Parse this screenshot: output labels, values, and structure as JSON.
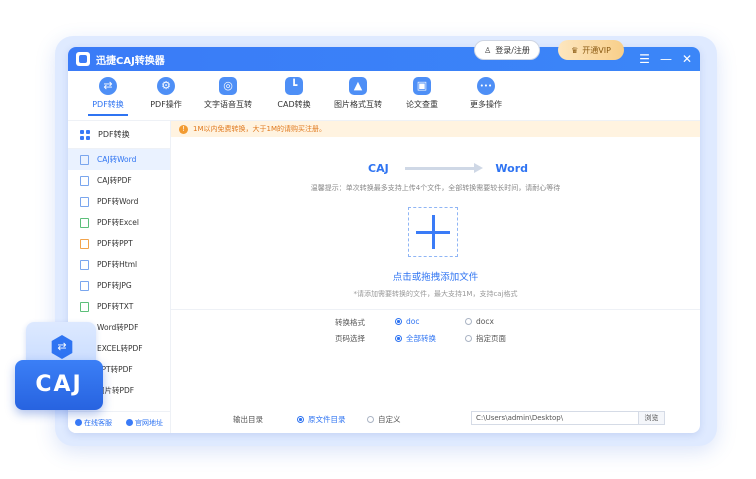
{
  "window": {
    "title": "迅捷CAJ转换器",
    "controls": [
      "☰",
      "—",
      "✕"
    ]
  },
  "toolbar": {
    "tools": [
      {
        "label": "PDF转换",
        "icon": "⇄",
        "icon_name": "convert-icon"
      },
      {
        "label": "PDF操作",
        "icon": "⚙",
        "icon_name": "pdf-tools-icon"
      },
      {
        "label": "文字语音互转",
        "icon": "◎",
        "icon_name": "speech-icon"
      },
      {
        "label": "CAD转换",
        "icon": "┗",
        "icon_name": "cad-icon"
      },
      {
        "label": "图片格式互转",
        "icon": "▲",
        "icon_name": "image-icon"
      },
      {
        "label": "论文查重",
        "icon": "▣",
        "icon_name": "paper-check-icon"
      },
      {
        "label": "更多操作",
        "icon": "•••",
        "icon_name": "more-icon"
      }
    ],
    "login_label": "登录/注册",
    "vip_label": "开通VIP"
  },
  "sidebar": {
    "header": "PDF转换",
    "items": [
      {
        "label": "CAJ转Word",
        "color": "blue"
      },
      {
        "label": "CAJ转PDF",
        "color": "blue"
      },
      {
        "label": "PDF转Word",
        "color": "blue"
      },
      {
        "label": "PDF转Excel",
        "color": "green"
      },
      {
        "label": "PDF转PPT",
        "color": "orange"
      },
      {
        "label": "PDF转Html",
        "color": "blue"
      },
      {
        "label": "PDF转JPG",
        "color": "blue"
      },
      {
        "label": "PDF转TXT",
        "color": "green"
      },
      {
        "label": "Word转PDF",
        "color": "blue"
      },
      {
        "label": "EXCEL转PDF",
        "color": "green"
      },
      {
        "label": "PPT转PDF",
        "color": "orange"
      },
      {
        "label": "图片转PDF",
        "color": "blue"
      }
    ],
    "footer": {
      "service": "在线客服",
      "website": "官网地址"
    }
  },
  "notice": "1M以内免费转换，大于1M的请购买注册。",
  "main": {
    "from_format": "CAJ",
    "to_format": "Word",
    "hint_top": "温馨提示：单次转换最多支持上传4个文件，全部转换需要较长时间，请耐心等待",
    "add_label": "点击或拖拽添加文件",
    "hint_bottom": "*请添加需要转换的文件，最大支持1M，支持caj格式",
    "format_label": "转换格式",
    "format_options": [
      "doc",
      "docx"
    ],
    "page_label": "页码选择",
    "page_options": [
      "全部转换",
      "指定页面"
    ],
    "output_label": "输出目录",
    "output_options": [
      "原文件目录",
      "自定义"
    ],
    "output_path": "C:\\Users\\admin\\Desktop\\",
    "browse_label": "浏览"
  },
  "badge": {
    "text": "CAJ"
  }
}
